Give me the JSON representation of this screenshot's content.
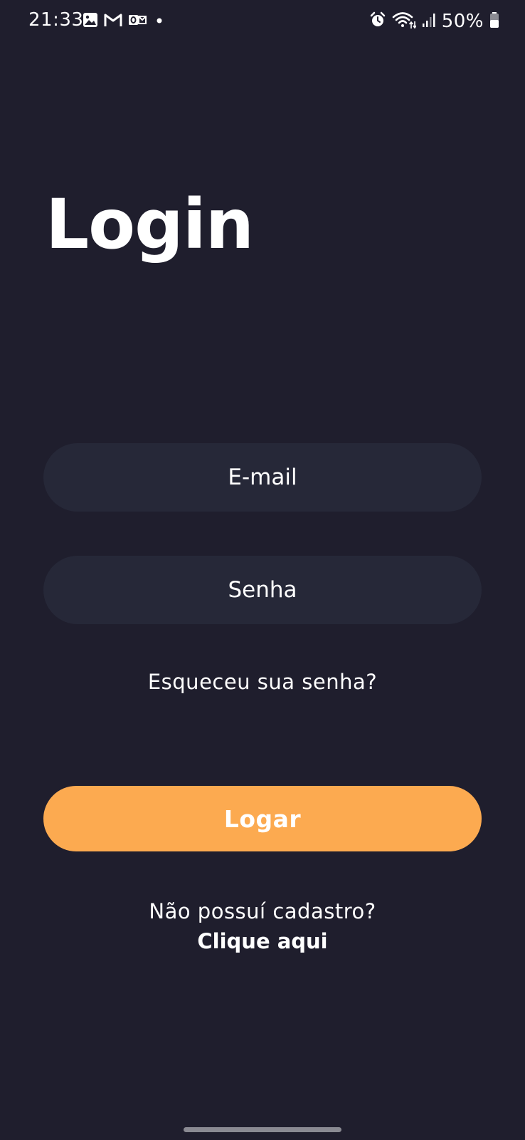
{
  "status_bar": {
    "time": "21:33",
    "left_icons": [
      "gallery-icon",
      "gmail-icon",
      "outlook-icon",
      "dot-icon"
    ],
    "right_icons": [
      "alarm-icon",
      "wifi-icon",
      "signal-icon",
      "battery-icon"
    ],
    "battery": "50%"
  },
  "page": {
    "title": "Login"
  },
  "form": {
    "email_placeholder": "E-mail",
    "password_placeholder": "Senha",
    "forgot_password": "Esqueceu sua senha?",
    "submit_label": "Logar"
  },
  "signup": {
    "prompt": "Não possuí cadastro?",
    "link": "Clique aqui"
  },
  "colors": {
    "background": "#1f1e2d",
    "field_background": "#262838",
    "accent": "#fcaa50",
    "text": "#ffffff"
  }
}
